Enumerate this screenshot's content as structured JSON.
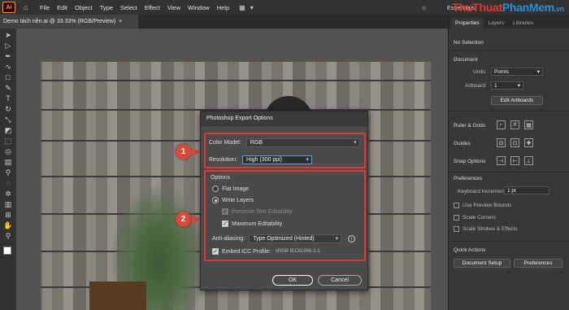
{
  "app": {
    "logo": "Ai",
    "home_icon": "home-icon"
  },
  "menu": [
    "File",
    "Edit",
    "Object",
    "Type",
    "Select",
    "Effect",
    "View",
    "Window",
    "Help"
  ],
  "workspace": "Essentials",
  "watermark": {
    "text_a": "ThuThuat",
    "text_b": "PhanMem",
    "text_c": ".vn",
    "color_a": "#e03a2f",
    "color_b": "#2a8fd6"
  },
  "document_tab": {
    "title": "Demo tách nền.ai @ 33.33% (RGB/Preview)",
    "close": "×"
  },
  "callouts": [
    "1",
    "2"
  ],
  "dialog": {
    "title": "Photoshop Export Options",
    "color_model_label": "Color Model:",
    "color_model_value": "RGB",
    "resolution_label": "Resolution:",
    "resolution_value": "High (300 ppi)",
    "options_label": "Options",
    "flat_image": "Flat Image",
    "write_layers": "Write Layers",
    "preserve_text": "Preserve Text Editability",
    "max_edit": "Maximum Editability",
    "antialias_label": "Anti-aliasing:",
    "antialias_value": "Type Optimized (Hinted)",
    "embed_icc": "Embed ICC Profile:",
    "icc_value": "sRGB IEC61966-2.1",
    "ok": "OK",
    "cancel": "Cancel"
  },
  "panel": {
    "tabs": [
      "Properties",
      "Layers",
      "Libraries"
    ],
    "no_selection": "No Selection",
    "document": "Document",
    "units_label": "Units:",
    "units_value": "Points",
    "artboard_label": "Artboard:",
    "artboard_value": "1",
    "edit_artboards": "Edit Artboards",
    "rulers_grids": "Ruler & Grids",
    "guides": "Guides",
    "snap_options": "Snap Options",
    "preferences": "Preferences",
    "keyboard_increment_label": "Keyboard Increment:",
    "keyboard_increment_value": "1 pt",
    "use_preview_bounds": "Use Preview Bounds",
    "scale_corners": "Scale Corners",
    "scale_strokes": "Scale Strokes & Effects",
    "quick_actions": "Quick Actions",
    "document_setup": "Document Setup",
    "preferences_btn": "Preferences"
  }
}
